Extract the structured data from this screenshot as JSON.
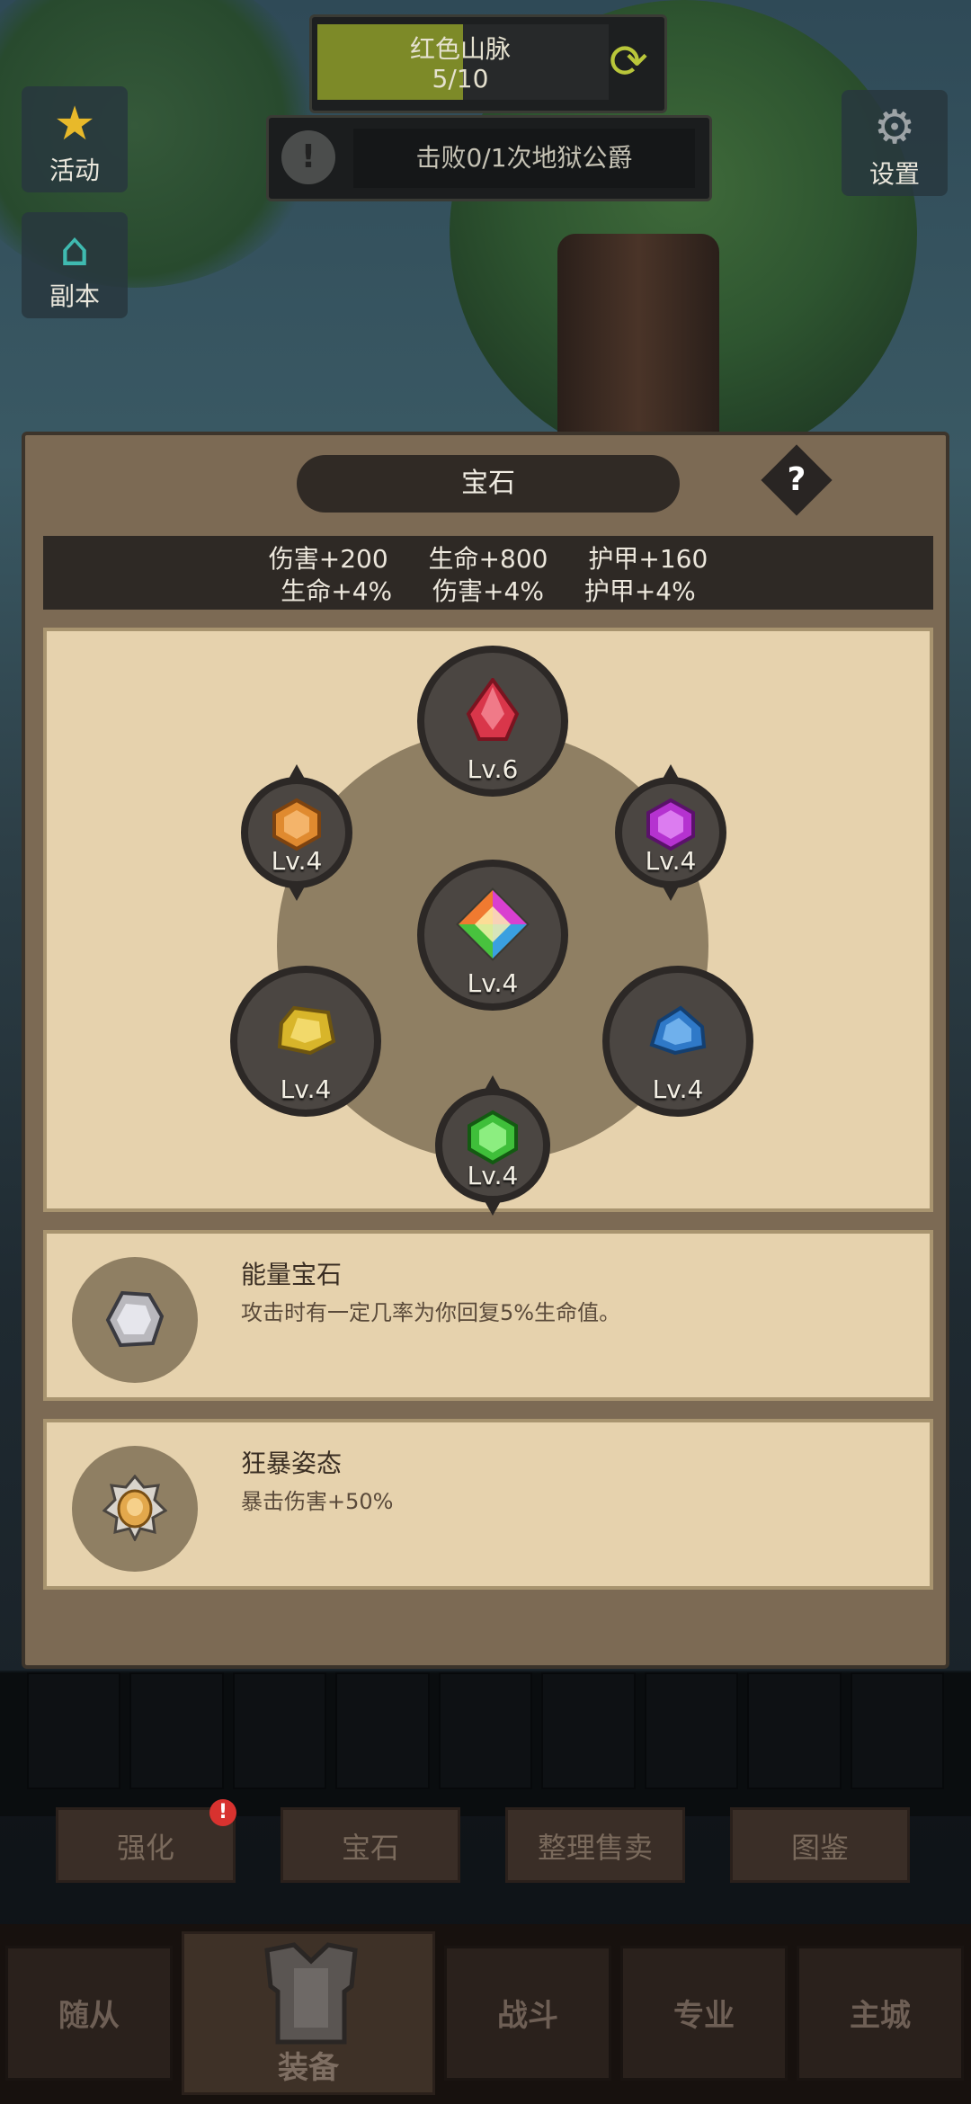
{
  "hud": {
    "stage_name": "红色山脉",
    "stage_progress": "5/10",
    "stage_progress_fraction": 0.5,
    "quest_text": "击败0/1次地狱公爵",
    "quest_icon": "!",
    "refresh_icon": "refresh-icon"
  },
  "side_buttons": {
    "activity_label": "活动",
    "dungeon_label": "副本",
    "settings_label": "设置"
  },
  "panel": {
    "title": "宝石",
    "help": "?",
    "stats_row1": [
      "伤害+200",
      "生命+800",
      "护甲+160"
    ],
    "stats_row2": [
      "生命+4%",
      "伤害+4%",
      "护甲+4%"
    ]
  },
  "gems": [
    {
      "name": "red-gem",
      "level": "Lv.6",
      "color": "#d9364a"
    },
    {
      "name": "orange-gem",
      "level": "Lv.4",
      "color": "#e08a2f"
    },
    {
      "name": "purple-gem",
      "level": "Lv.4",
      "color": "#b532d0"
    },
    {
      "name": "rainbow-gem",
      "level": "Lv.4",
      "color": "#c8c240"
    },
    {
      "name": "yellow-gem",
      "level": "Lv.4",
      "color": "#d8b52a"
    },
    {
      "name": "blue-gem",
      "level": "Lv.4",
      "color": "#2f79c8"
    },
    {
      "name": "green-gem",
      "level": "Lv.4",
      "color": "#3fbf3a"
    }
  ],
  "skills": [
    {
      "name": "能量宝石",
      "desc": "攻击时有一定几率为你回复5%生命值。",
      "icon": "energy-gem-icon",
      "color": "#b9b8bd"
    },
    {
      "name": "狂暴姿态",
      "desc": "暴击伤害+50%",
      "icon": "berserk-stance-icon",
      "color": "#e3a84c"
    }
  ],
  "subtabs": [
    "强化",
    "宝石",
    "整理售卖",
    "图鉴"
  ],
  "subtab_badge": "!",
  "nav": [
    "随从",
    "装备",
    "战斗",
    "专业",
    "主城"
  ]
}
